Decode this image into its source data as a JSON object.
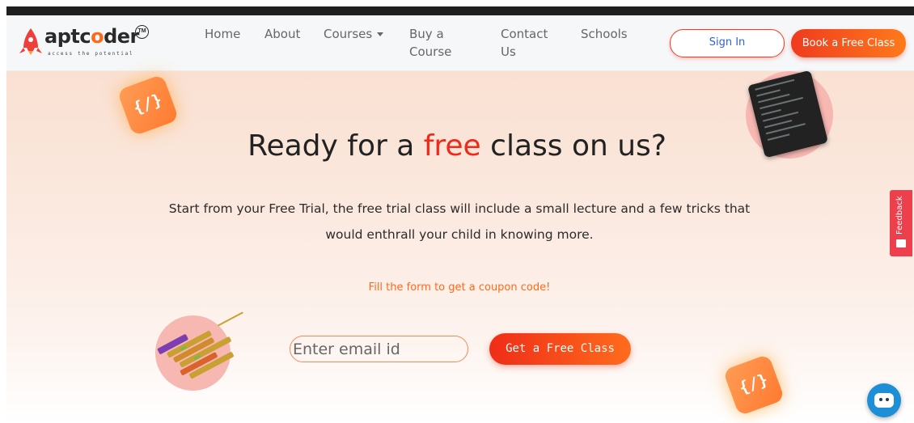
{
  "brand": {
    "name_prefix": "aptc",
    "name_o": "o",
    "name_suffix": "der",
    "tm": "TM",
    "tagline": "access the potential"
  },
  "nav": {
    "home": "Home",
    "about": "About",
    "courses": "Courses",
    "buy_line1": "Buy a",
    "buy_line2": "Course",
    "contact_line1": "Contact",
    "contact_line2": "Us",
    "schools": "Schools"
  },
  "header_buttons": {
    "sign_in": "Sign In",
    "book": "Book a Free Class"
  },
  "hero": {
    "heading_before": "Ready for a ",
    "heading_accent": "free",
    "heading_after": " class on us?",
    "subtext": "Start from your Free Trial, the free trial class will include a small lecture and a few tricks that would enthrall your child in knowing more.",
    "coupon": "Fill the form to get a coupon code!",
    "email_placeholder": "Enter email id",
    "cta": "Get a Free Class"
  },
  "decor": {
    "code_tile_glyph": "{/}"
  },
  "widgets": {
    "feedback": "Feedback"
  },
  "colors": {
    "accent_red": "#ee2a1b",
    "accent_orange": "#ff6a1a",
    "sign_in_text": "#2f62d9",
    "feedback_bg": "#ee3f4d",
    "chat_bg": "#1d8fd6"
  },
  "icons": {
    "logo": "rocket-icon",
    "courses_caret": "chevron-down-icon",
    "feedback": "message-icon",
    "chat": "chatbot-icon"
  }
}
